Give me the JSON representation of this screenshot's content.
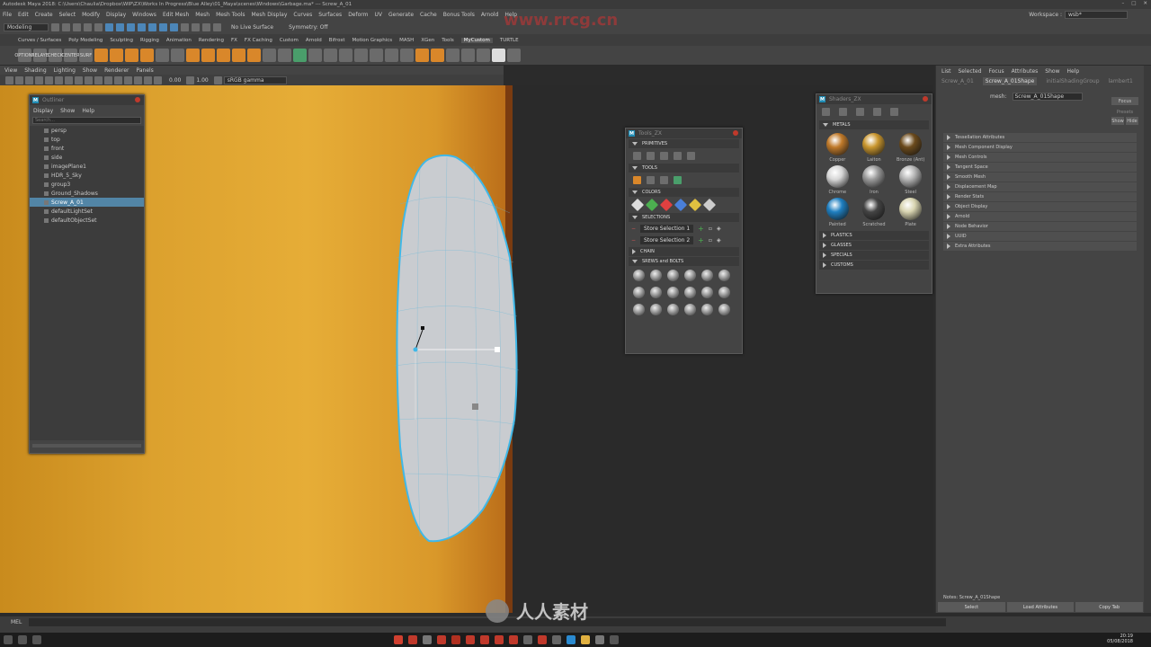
{
  "titlebar": {
    "title": "Autodesk Maya 2018: C:\\Users\\Chaulia\\Dropbox\\WIP\\ZX\\Works In Progress\\Blue Alley\\01_Maya\\scenes\\Windows\\Garbage.ma* --- Screw_A_01"
  },
  "menubar": {
    "items": [
      "File",
      "Edit",
      "Create",
      "Select",
      "Modify",
      "Display",
      "Windows",
      "Edit Mesh",
      "Mesh",
      "Mesh Tools",
      "Mesh Display",
      "Curves",
      "Surfaces",
      "Deform",
      "UV",
      "Generate",
      "Cache",
      "Bonus Tools",
      "Arnold",
      "Help"
    ],
    "workspace_label": "Workspace :",
    "workspace_value": "wsb*"
  },
  "statusline": {
    "mode": "Modeling",
    "live_surface": "No Live Surface",
    "symmetry": "Symmetry: Off"
  },
  "shelf": {
    "tabs": [
      "Curves / Surfaces",
      "Poly Modeling",
      "Sculpting",
      "Rigging",
      "Animation",
      "Rendering",
      "FX",
      "FX Caching",
      "Custom",
      "Arnold",
      "Bifrost",
      "Motion Graphics",
      "MASH",
      "XGen",
      "Tools",
      "MyCustom",
      "TURTLE"
    ],
    "active_tab": "MyCustom",
    "left_labels": [
      "OPTIONS",
      "RELAYE",
      "CHECK",
      "CENTER",
      "SURF"
    ]
  },
  "panel_menu": {
    "items": [
      "View",
      "Shading",
      "Lighting",
      "Show",
      "Renderer",
      "Panels"
    ]
  },
  "viewport_toolbar": {
    "value1": "0.00",
    "value2": "1.00",
    "colorspace": "sRGB gamma"
  },
  "outliner": {
    "title": "Outliner",
    "menu": [
      "Display",
      "Show",
      "Help"
    ],
    "search_placeholder": "Search...",
    "items": [
      "persp",
      "top",
      "front",
      "side",
      "imagePlane1",
      "HDR_5_Sky",
      "group3",
      "Ground_Shadows",
      "Screw_A_01",
      "defaultLightSet",
      "defaultObjectSet"
    ],
    "selected": "Screw_A_01"
  },
  "tools_panel": {
    "title": "Tools_ZX",
    "sections": {
      "primitives": "PRIMITIVES",
      "tools": "TOOLS",
      "colors": "COLORS",
      "selections": "SELECTIONS",
      "chain": "CHAIN",
      "screws": "SREWS and BOLTS"
    },
    "store_1": "Store Selection 1",
    "store_2": "Store Selection 2"
  },
  "materials_panel": {
    "title": "Shaders_ZX",
    "sections": {
      "metals": "METALS",
      "plastics": "PLASTICS",
      "glasses": "GLASSES",
      "specials": "SPECIALS",
      "customs": "CUSTOMS"
    },
    "materials": [
      "Copper",
      "Laiton",
      "Bronze (Ant)",
      "Chrome",
      "Iron",
      "Steel",
      "Painted",
      "Scratched",
      "Plate"
    ],
    "colors": [
      "#c07a2a",
      "#c9962e",
      "#6b4a1c",
      "#d7d7d7",
      "#9a9a9a",
      "#b5b5b5",
      "#1f7fc0",
      "#444444",
      "#d8d4b0"
    ]
  },
  "attribute_editor": {
    "menu": [
      "List",
      "Selected",
      "Focus",
      "Attributes",
      "Show",
      "Help"
    ],
    "tabs": [
      "Screw_A_01",
      "Screw_A_01Shape",
      "initialShadingGroup",
      "lambert1"
    ],
    "active_tab": "Screw_A_01Shape",
    "mesh_label": "mesh:",
    "mesh_value": "Screw_A_01Shape",
    "focus_label": "Focus",
    "presets_label": "Presets",
    "show_label": "Show",
    "hide_label": "Hide",
    "sections": [
      "Tessellation Attributes",
      "Mesh Component Display",
      "Mesh Controls",
      "Tangent Space",
      "Smooth Mesh",
      "Displacement Map",
      "Render Stats",
      "Object Display",
      "Arnold",
      "Node Behavior",
      "UUID",
      "Extra Attributes"
    ],
    "notes": "Notes: Screw_A_01Shape",
    "buttons": [
      "Select",
      "Load Attributes",
      "Copy Tab"
    ]
  },
  "cmdline": {
    "label": "MEL"
  },
  "taskbar": {
    "time": "20:19",
    "date": "05/08/2018"
  },
  "watermark": {
    "center_text": "人人素材",
    "top_text": "www.rrcg.cn"
  }
}
